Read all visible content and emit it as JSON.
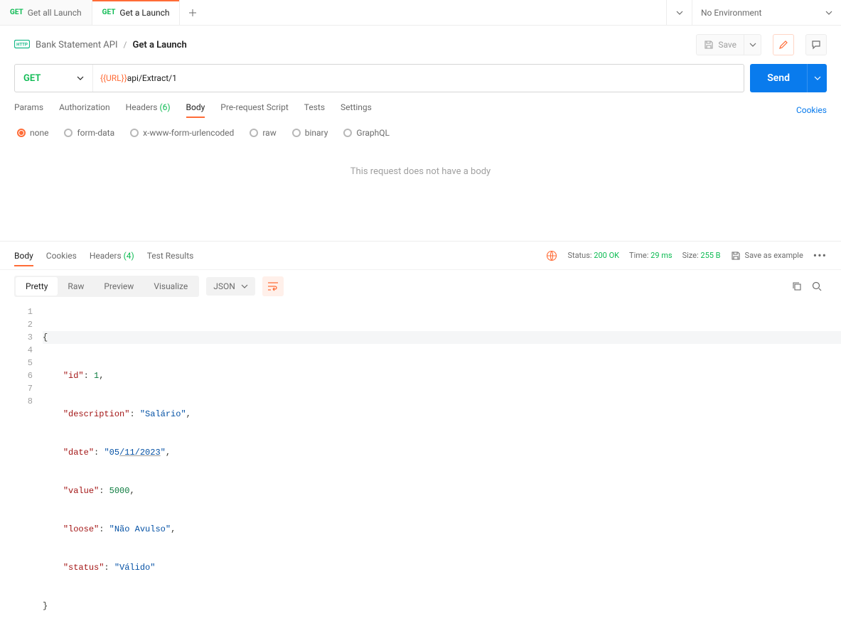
{
  "tabs": [
    {
      "method": "GET",
      "label": "Get all Launch",
      "active": false
    },
    {
      "method": "GET",
      "label": "Get a Launch",
      "active": true
    }
  ],
  "env": {
    "label": "No Environment"
  },
  "breadcrumb": {
    "collection": "Bank Statement API",
    "current": "Get a Launch",
    "save_label": "Save"
  },
  "request": {
    "method": "GET",
    "url_var": "{{URL}}",
    "url_path": "api/Extract/1",
    "send_label": "Send",
    "tabs": {
      "params": "Params",
      "auth": "Authorization",
      "headers": "Headers",
      "headers_count": "(6)",
      "body": "Body",
      "prescript": "Pre-request Script",
      "tests": "Tests",
      "settings": "Settings",
      "cookies": "Cookies"
    },
    "body_types": {
      "none": "none",
      "formdata": "form-data",
      "urlencoded": "x-www-form-urlencoded",
      "raw": "raw",
      "binary": "binary",
      "graphql": "GraphQL"
    },
    "body_empty": "This request does not have a body"
  },
  "response": {
    "tabs": {
      "body": "Body",
      "cookies": "Cookies",
      "headers": "Headers",
      "headers_count": "(4)",
      "testresults": "Test Results"
    },
    "status_label": "Status:",
    "status_value": "200 OK",
    "time_label": "Time:",
    "time_value": "29 ms",
    "size_label": "Size:",
    "size_value": "255 B",
    "save_example": "Save as example",
    "view": {
      "pretty": "Pretty",
      "raw": "Raw",
      "preview": "Preview",
      "visualize": "Visualize",
      "format": "JSON"
    },
    "json": {
      "id_k": "\"id\"",
      "id_v": "1",
      "description_k": "\"description\"",
      "description_v": "\"Salário\"",
      "date_k": "\"date\"",
      "date_v_pre": "\"05",
      "date_v_mid": "/11/2023",
      "date_v_post": "\"",
      "value_k": "\"value\"",
      "value_v": "5000",
      "loose_k": "\"loose\"",
      "loose_v": "\"Não Avulso\"",
      "status_k": "\"status\"",
      "status_v": "\"Válido\""
    },
    "line_numbers": [
      "1",
      "2",
      "3",
      "4",
      "5",
      "6",
      "7",
      "8"
    ]
  }
}
